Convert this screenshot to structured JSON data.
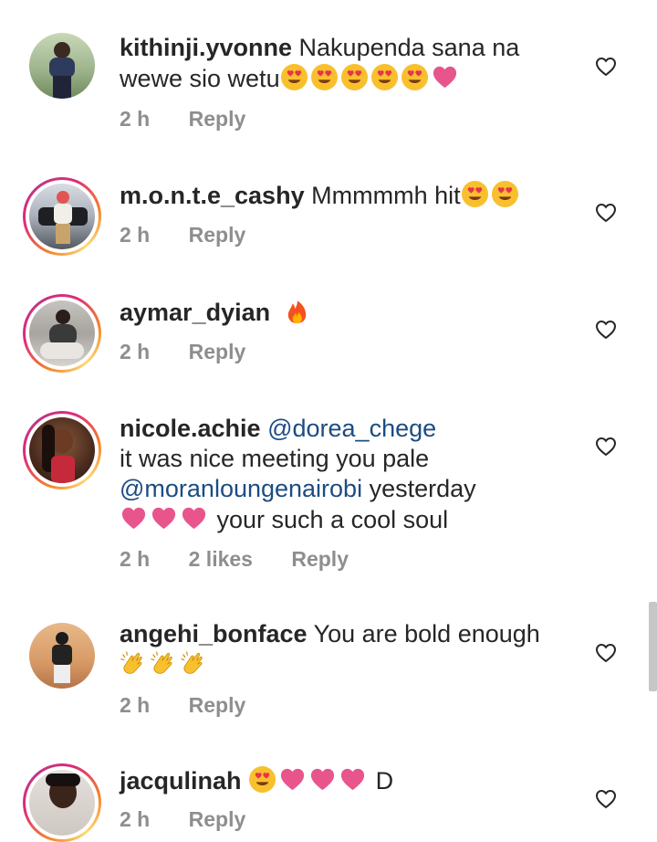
{
  "comments": [
    {
      "username": "kithinji.yvonne",
      "text": "Nakupenda sana na wewe sio wetu",
      "emojis": [
        "heart-eyes-icon",
        "heart-eyes-icon",
        "heart-eyes-icon",
        "heart-eyes-icon",
        "heart-eyes-icon",
        "pink-heart-icon"
      ],
      "time": "2 h",
      "reply": "Reply"
    },
    {
      "username": "m.o.n.t.e_cashy",
      "text": "Mmmmmh hit",
      "emojis": [
        "heart-eyes-icon",
        "heart-eyes-icon"
      ],
      "time": "2 h",
      "reply": "Reply"
    },
    {
      "username": "aymar_dyian",
      "text": "",
      "emojis": [
        "fire-icon"
      ],
      "time": "2 h",
      "reply": "Reply"
    },
    {
      "username": "nicole.achie",
      "mention1": "@dorea_chege",
      "line2": "it was nice meeting you pale",
      "mention2": "@moranloungenairobi",
      "line3_rest": "yesterday",
      "line4_text": "your such a cool soul",
      "emojis": [
        "pink-heart-icon",
        "pink-heart-icon",
        "pink-heart-icon"
      ],
      "time": "2 h",
      "likes": "2 likes",
      "reply": "Reply"
    },
    {
      "username": "angehi_bonface",
      "text": "You are bold enough",
      "emojis": [
        "clapping-hands-icon",
        "clapping-hands-icon",
        "clapping-hands-icon"
      ],
      "time": "2 h",
      "reply": "Reply"
    },
    {
      "username": "jacqulinah",
      "text": "D",
      "emojis": [
        "heart-eyes-icon",
        "pink-heart-icon",
        "pink-heart-icon",
        "pink-heart-icon"
      ],
      "time": "2 h",
      "reply": "Reply"
    }
  ],
  "colors": {
    "username": "#262626",
    "mention": "#1c4c83",
    "meta": "#8e8e8e",
    "heart_emoji": "#e8558d",
    "story_ring_start": "#f58529",
    "story_ring_end": "#dd2a7b"
  }
}
